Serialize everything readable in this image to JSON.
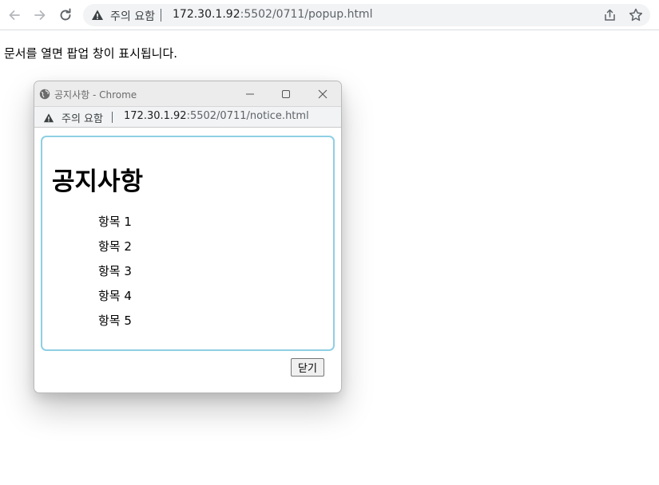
{
  "browser": {
    "security_label": "주의 요함",
    "url_host": "172.30.1.92",
    "url_path": ":5502/0711/popup.html",
    "icons": [
      "back-arrow-icon",
      "forward-arrow-icon",
      "reload-icon",
      "warning-icon",
      "share-icon",
      "star-icon"
    ]
  },
  "page": {
    "text": "문서를 열면 팝업 창이 표시됩니다."
  },
  "popup": {
    "window_title": "공지사항 - Chrome",
    "security_label": "주의 요함",
    "url_host": "172.30.1.92",
    "url_path": ":5502/0711/notice.html",
    "heading": "공지사항",
    "items": [
      "항목 1",
      "항목 2",
      "항목 3",
      "항목 4",
      "항목 5"
    ],
    "close_label": "닫기",
    "icons": [
      "globe-icon",
      "minimize-icon",
      "maximize-icon",
      "close-window-icon",
      "warning-icon"
    ]
  },
  "colors": {
    "content_border": "#8fcfe3",
    "titlebar": "#ececec",
    "omnibox": "#f1f3f4"
  }
}
